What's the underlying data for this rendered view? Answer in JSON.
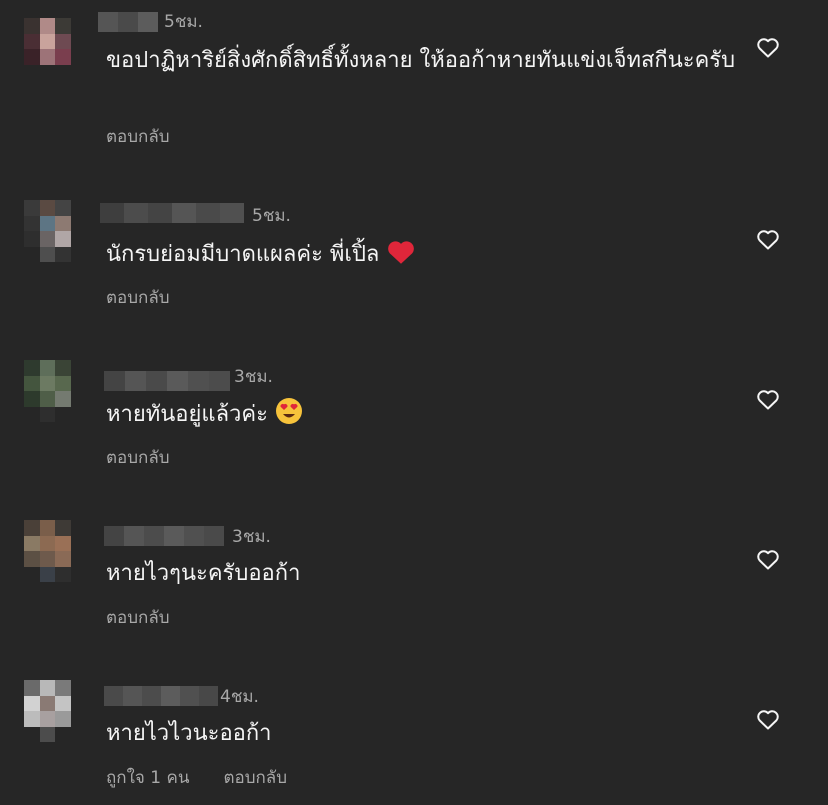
{
  "comments": [
    {
      "time": "5ชม.",
      "text": "ขอปาฏิหาริย์สิ่งศักดิ์สิทธิ์ทั้งหลาย ให้ออก้าหายทันแข่งเจ็ทสกีนะครับ",
      "reply": "ตอบกลับ",
      "heart_icon": "heart-outline-icon"
    },
    {
      "time": "5ชม.",
      "text": "นักรบย่อมมีบาดแผลค่ะ พี่เปิ้ล",
      "emoji": "red-heart",
      "reply": "ตอบกลับ",
      "heart_icon": "heart-outline-icon"
    },
    {
      "time": "3ชม.",
      "text": "หายทันอยู่แล้วค่ะ",
      "emoji": "heart-eyes",
      "reply": "ตอบกลับ",
      "heart_icon": "heart-outline-icon"
    },
    {
      "time": "3ชม.",
      "text": "หายไวๆนะครับออก้า",
      "reply": "ตอบกลับ",
      "heart_icon": "heart-outline-icon"
    },
    {
      "time": "4ชม.",
      "text": "หายไวไวนะออก้า",
      "likes": "ถูกใจ 1 คน",
      "reply": "ตอบกลับ",
      "heart_icon": "heart-outline-icon"
    }
  ],
  "colors": {
    "background": "#262626",
    "text": "#f5f5f5",
    "muted": "#a8a8a8",
    "emoji_heart": "#e0263a",
    "emoji_face": "#f7c33b"
  }
}
